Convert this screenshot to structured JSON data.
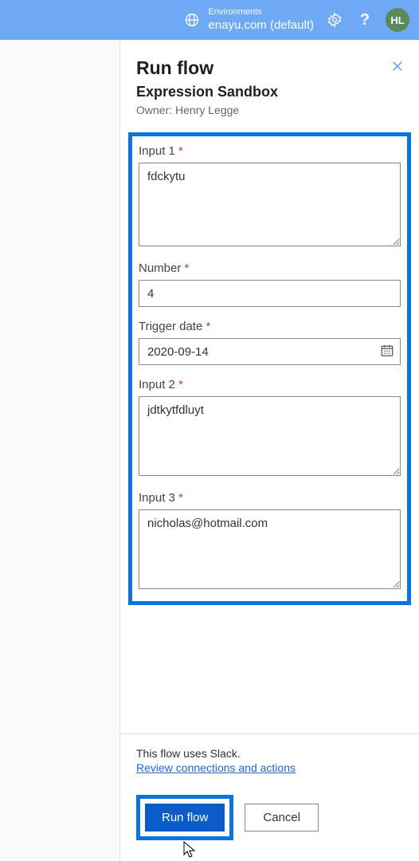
{
  "header": {
    "env_label": "Environments",
    "env_name": "enayu.com (default)",
    "avatar_initials": "HL"
  },
  "panel": {
    "title": "Run flow",
    "subtitle": "Expression Sandbox",
    "owner": "Owner: Henry Legge"
  },
  "fields": {
    "input1": {
      "label": "Input 1",
      "value": "fdckytu"
    },
    "number": {
      "label": "Number",
      "value": "4"
    },
    "trigger_date": {
      "label": "Trigger date",
      "value": "2020-09-14"
    },
    "input2": {
      "label": "Input 2",
      "value": "jdtkytfdluyt"
    },
    "input3": {
      "label": "Input 3",
      "value": "nicholas@hotmail.com"
    }
  },
  "footer": {
    "uses_text": "This flow uses Slack.",
    "review_link": "Review connections and actions",
    "run_label": "Run flow",
    "cancel_label": "Cancel"
  }
}
